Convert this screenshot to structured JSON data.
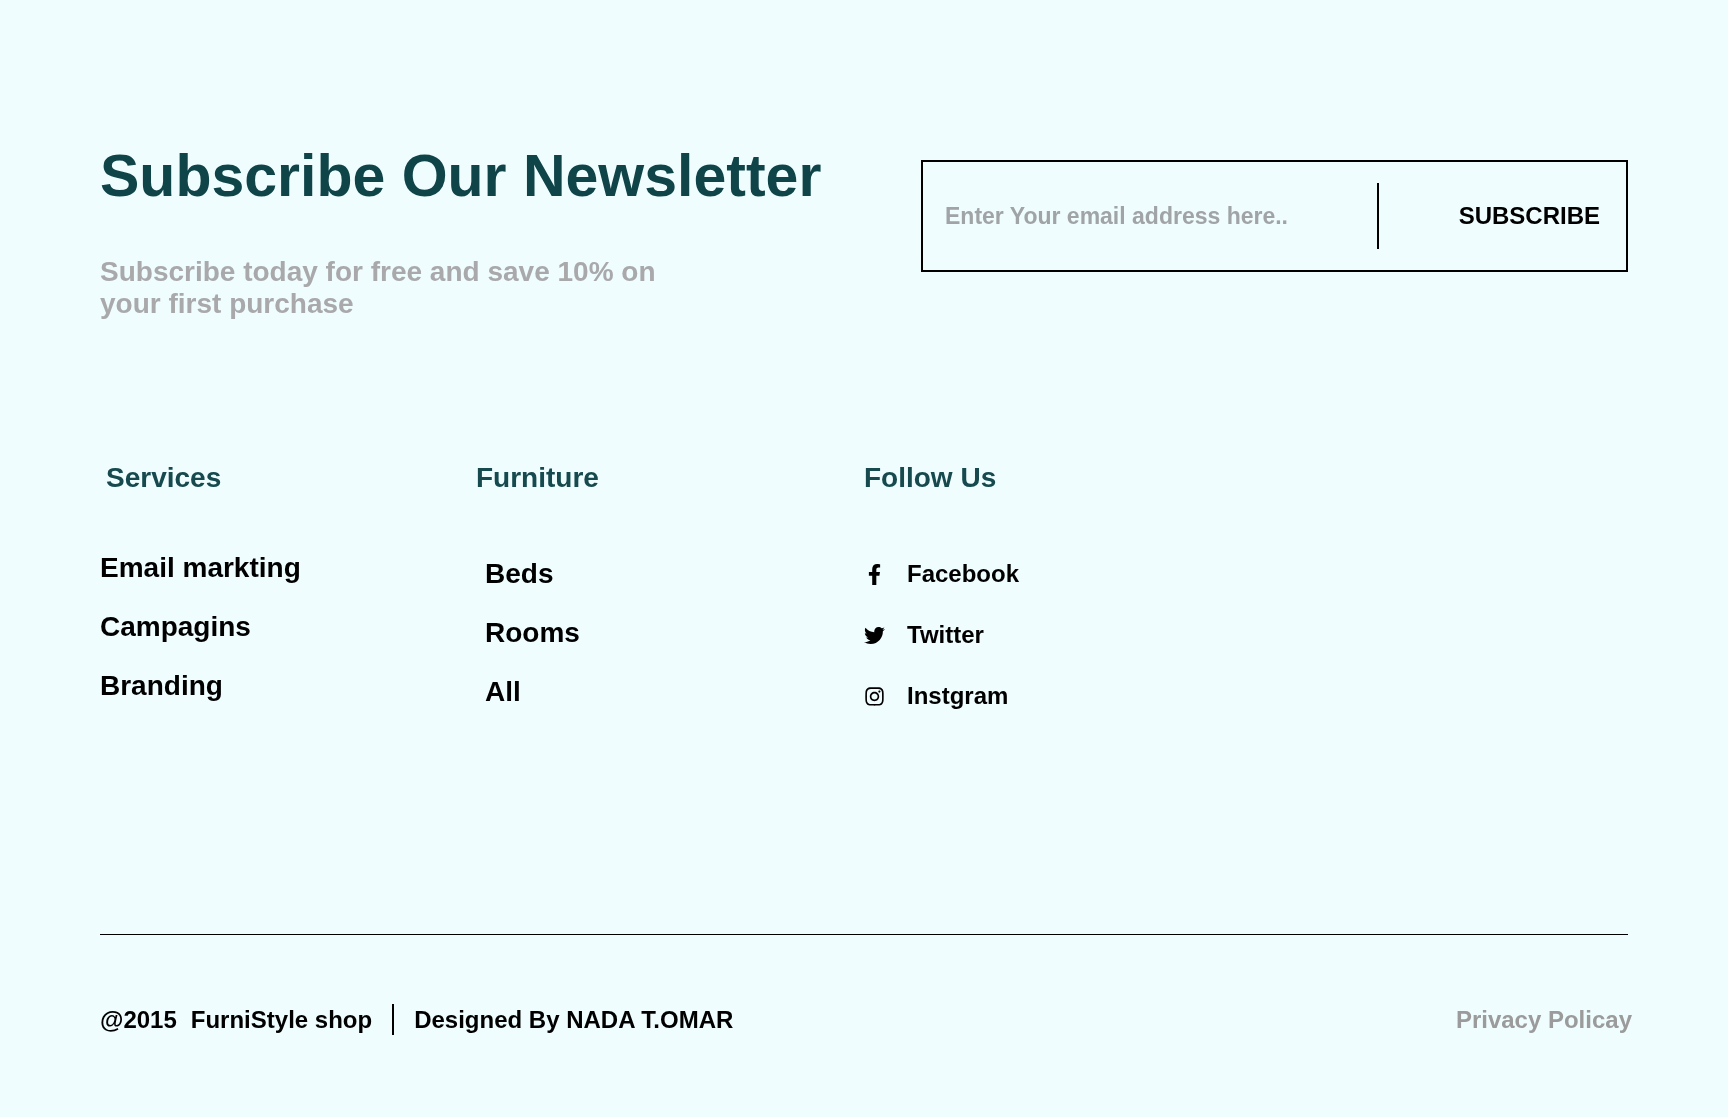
{
  "newsletter": {
    "title": "Subscribe Our Newsletter",
    "subtitle": "Subscribe today for free and save 10% on your first purchase",
    "email_field": {
      "placeholder": "Enter Your email address here.."
    },
    "subscribe_button": "SUBSCRIBE"
  },
  "columns": [
    {
      "heading": "Services",
      "kind": "links",
      "items": [
        "Email markting",
        "Campagins",
        "Branding"
      ]
    },
    {
      "heading": "Furniture",
      "kind": "links",
      "items": [
        "Beds",
        "Rooms",
        "All"
      ]
    },
    {
      "heading": "Follow Us",
      "kind": "social",
      "items": [
        "Facebook",
        "Twitter",
        "Instgram"
      ]
    }
  ],
  "footer": {
    "copyright": "@2015",
    "shop": "FurniStyle shop",
    "credit": "Designed By NADA T.OMAR",
    "privacy_link": "Privacy Policay"
  }
}
